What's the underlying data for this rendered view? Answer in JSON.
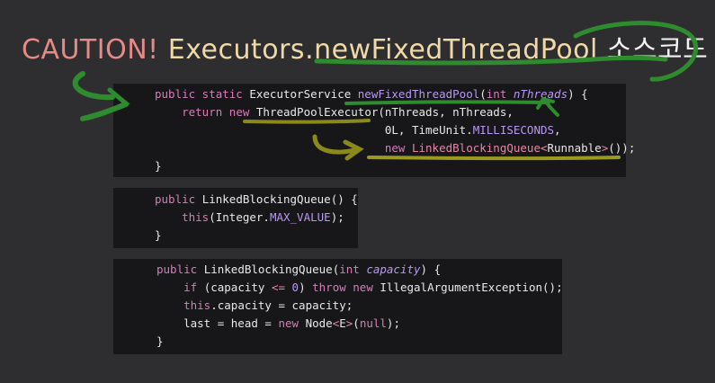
{
  "title": {
    "caution": "CAUTION!",
    "method": "Executors.newFixedThreadPool",
    "suffix": "소스코드"
  },
  "code_blocks": [
    {
      "lines": [
        [
          [
            "kw",
            "public static "
          ],
          [
            "cl",
            "ExecutorService "
          ],
          [
            "fn",
            "newFixedThreadPool"
          ],
          [
            "pn",
            "("
          ],
          [
            "kw",
            "int "
          ],
          [
            "pr",
            "nThreads"
          ],
          [
            "pn",
            ") {"
          ]
        ],
        [
          [
            "pn",
            "    "
          ],
          [
            "kw",
            "return new "
          ],
          [
            "cl",
            "ThreadPoolExecutor"
          ],
          [
            "pn",
            "(nThreads, nThreads,"
          ]
        ],
        [
          [
            "pn",
            "                                  0L, TimeUnit."
          ],
          [
            "ct",
            "MILLISECONDS"
          ],
          [
            "pn",
            ","
          ]
        ],
        [
          [
            "pn",
            "                                  "
          ],
          [
            "kw",
            "new "
          ],
          [
            "op",
            "LinkedBlockingQueue<"
          ],
          [
            "cl",
            "Runnable"
          ],
          [
            "op",
            ">"
          ],
          [
            "pn",
            "());"
          ]
        ],
        [
          [
            "pn",
            "}"
          ]
        ]
      ]
    },
    {
      "lines": [
        [
          [
            "kw",
            "public "
          ],
          [
            "cl",
            "LinkedBlockingQueue"
          ],
          [
            "pn",
            "() {"
          ]
        ],
        [
          [
            "pn",
            "    "
          ],
          [
            "kw",
            "this"
          ],
          [
            "pn",
            "(Integer."
          ],
          [
            "ct",
            "MAX_VALUE"
          ],
          [
            "pn",
            ");"
          ]
        ],
        [
          [
            "pn",
            "}"
          ]
        ]
      ]
    },
    {
      "lines": [
        [
          [
            "kw",
            "public "
          ],
          [
            "cl",
            "LinkedBlockingQueue"
          ],
          [
            "pn",
            "("
          ],
          [
            "kw",
            "int "
          ],
          [
            "pr",
            "capacity"
          ],
          [
            "pn",
            ") {"
          ]
        ],
        [
          [
            "pn",
            "    "
          ],
          [
            "kw",
            "if "
          ],
          [
            "pn",
            "(capacity "
          ],
          [
            "op",
            "<= "
          ],
          [
            "nm",
            "0"
          ],
          [
            "pn",
            ") "
          ],
          [
            "kw",
            "throw new "
          ],
          [
            "cl",
            "IllegalArgumentException"
          ],
          [
            "pn",
            "();"
          ]
        ],
        [
          [
            "pn",
            "    "
          ],
          [
            "kw",
            "this"
          ],
          [
            "pn",
            ".capacity = capacity;"
          ]
        ],
        [
          [
            "pn",
            "    last = head = "
          ],
          [
            "kw",
            "new "
          ],
          [
            "cl",
            "Node"
          ],
          [
            "op",
            "<"
          ],
          [
            "cl",
            "E"
          ],
          [
            "op",
            ">"
          ],
          [
            "pn",
            "("
          ],
          [
            "kw",
            "null"
          ],
          [
            "pn",
            ");"
          ]
        ],
        [
          [
            "pn",
            "}"
          ]
        ]
      ]
    }
  ],
  "colors": {
    "background": "#2e2e30",
    "panel": "#17171a",
    "annotation_green": "#2e8b2e",
    "annotation_olive": "#9a9a22"
  }
}
